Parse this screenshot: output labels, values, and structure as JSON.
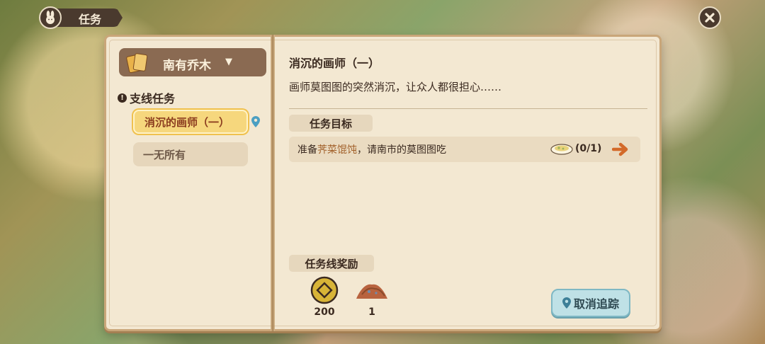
{
  "header": {
    "title": "任务",
    "title_icon": "rabbit-icon",
    "close_icon": "close-icon"
  },
  "left_page": {
    "npc_tab": {
      "name": "南有乔木",
      "icon": "cards-icon",
      "dropdown_icon": "triangle-down-icon"
    },
    "section_label": "支线任务",
    "quests": [
      {
        "label": "消沉的画师（一）",
        "active": true
      },
      {
        "label": "一无所有",
        "active": false
      }
    ]
  },
  "right_page": {
    "quest_title": "消沉的画师（一）",
    "quest_desc": "画师莫图图的突然消沉，让众人都很担心……",
    "goal_heading": "任务目标",
    "goal": {
      "prefix": "准备",
      "item": "荠菜馄饨",
      "suffix": "，请南市的莫图图吃",
      "progress": "(0/1)"
    },
    "reward_heading": "任务线奖励",
    "rewards": [
      {
        "icon": "coin-icon",
        "amount": "200"
      },
      {
        "icon": "ore-pile-icon",
        "amount": "1"
      }
    ],
    "untrack_button": "取消追踪"
  },
  "colors": {
    "panel_bg": "#f3e8d2",
    "border": "#c9a679",
    "text": "#3b2a20",
    "active_quest": "#f6d77d",
    "highlight": "#a2612b",
    "button_teal": "#bfe1e6"
  }
}
